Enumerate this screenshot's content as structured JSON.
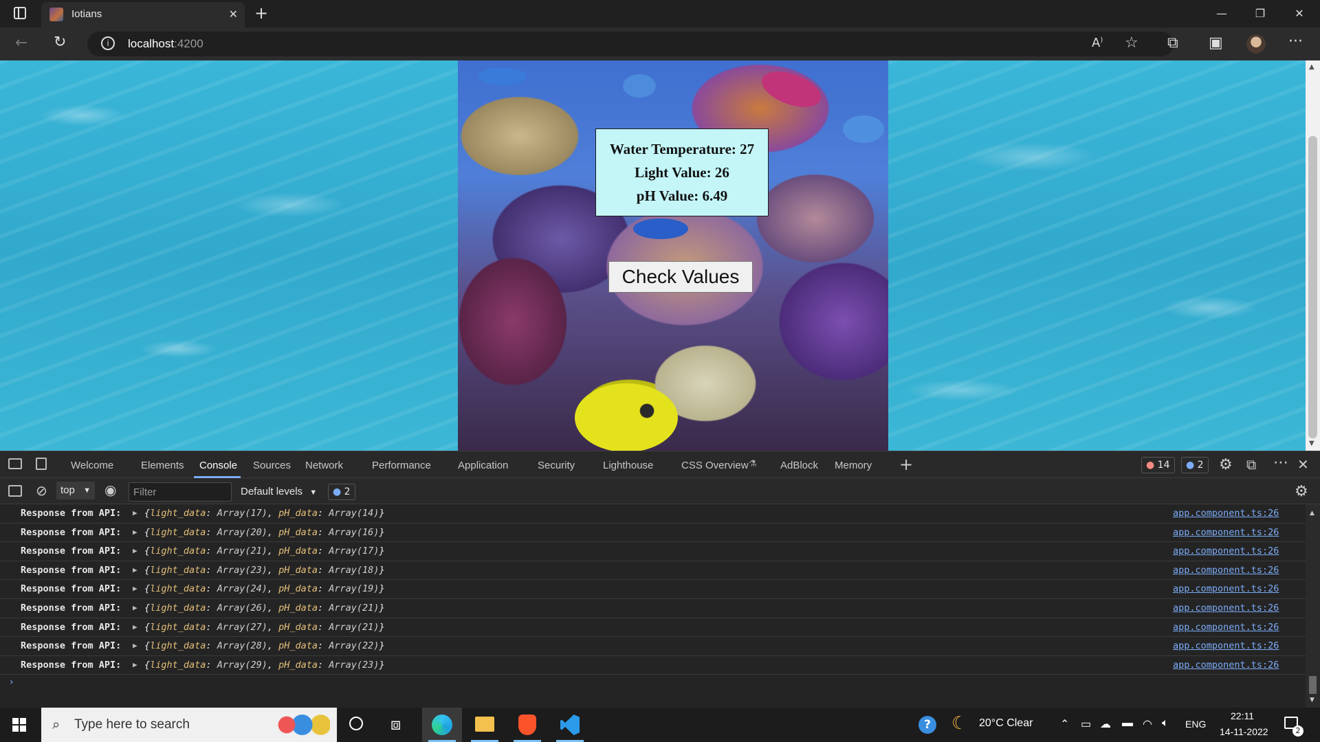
{
  "browser": {
    "tab_title": "Iotians",
    "url_host": "localhost",
    "url_port": ":4200"
  },
  "page": {
    "readings": {
      "water_temperature": "Water Temperature: 27",
      "light_value": "Light Value: 26",
      "ph_value": "pH Value: 6.49"
    },
    "check_button_label": "Check Values"
  },
  "devtools": {
    "tabs": [
      "Welcome",
      "Elements",
      "Console",
      "Sources",
      "Network",
      "Performance",
      "Application",
      "Security",
      "Lighthouse",
      "CSS Overview",
      "AdBlock",
      "Memory"
    ],
    "active_tab": "Console",
    "error_count": "14",
    "message_count": "2",
    "context": "top",
    "filter_placeholder": "Filter",
    "levels": "Default levels",
    "issues_count": "2",
    "console_rows": [
      {
        "label": "Response from API:",
        "light": "Array(17)",
        "ph": "Array(14)",
        "source": "app.component.ts:26"
      },
      {
        "label": "Response from API:",
        "light": "Array(20)",
        "ph": "Array(16)",
        "source": "app.component.ts:26"
      },
      {
        "label": "Response from API:",
        "light": "Array(21)",
        "ph": "Array(17)",
        "source": "app.component.ts:26"
      },
      {
        "label": "Response from API:",
        "light": "Array(23)",
        "ph": "Array(18)",
        "source": "app.component.ts:26"
      },
      {
        "label": "Response from API:",
        "light": "Array(24)",
        "ph": "Array(19)",
        "source": "app.component.ts:26"
      },
      {
        "label": "Response from API:",
        "light": "Array(26)",
        "ph": "Array(21)",
        "source": "app.component.ts:26"
      },
      {
        "label": "Response from API:",
        "light": "Array(27)",
        "ph": "Array(21)",
        "source": "app.component.ts:26"
      },
      {
        "label": "Response from API:",
        "light": "Array(28)",
        "ph": "Array(22)",
        "source": "app.component.ts:26"
      },
      {
        "label": "Response from API:",
        "light": "Array(29)",
        "ph": "Array(23)",
        "source": "app.component.ts:26"
      }
    ],
    "light_key": "light_data",
    "ph_key": "pH_data"
  },
  "taskbar": {
    "search_placeholder": "Type here to search",
    "weather": "20°C  Clear",
    "language": "ENG",
    "time": "22:11",
    "date": "14-11-2022",
    "notification_count": "2"
  },
  "colors": {
    "accent": "#7cacf8",
    "values_box_bg": "#c4f6f8",
    "water": "#31a9cd"
  }
}
